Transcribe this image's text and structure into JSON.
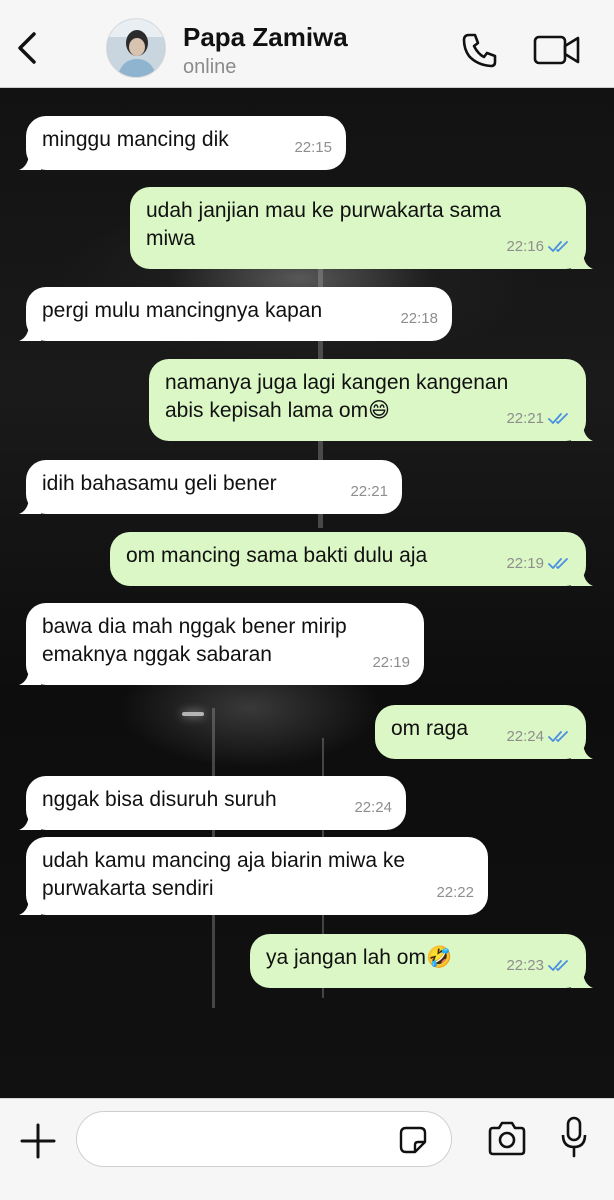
{
  "header": {
    "contact_name": "Papa Zamiwa",
    "status": "online"
  },
  "icons": {
    "back": "chevron-left-icon",
    "call": "phone-icon",
    "video": "video-camera-icon",
    "add": "plus-icon",
    "sticker": "sticker-icon",
    "camera": "camera-icon",
    "mic": "microphone-icon",
    "read_receipt": "double-check-icon"
  },
  "colors": {
    "incoming_bubble": "#ffffff",
    "outgoing_bubble": "#dbf7c5",
    "read_tick": "#4a90e2"
  },
  "messages": [
    {
      "dir": "in",
      "text": "minggu mancing dik",
      "time": "22:15"
    },
    {
      "dir": "out",
      "text": "udah janjian mau ke purwakarta sama\nmiwa",
      "time": "22:16"
    },
    {
      "dir": "in",
      "text": "pergi mulu mancingnya kapan",
      "time": "22:18"
    },
    {
      "dir": "out",
      "text": "namanya juga lagi kangen kangenan\nabis kepisah lama om😄",
      "time": "22:21"
    },
    {
      "dir": "in",
      "text": "idih bahasamu geli bener",
      "time": "22:21"
    },
    {
      "dir": "out",
      "text": "om mancing sama bakti dulu aja",
      "time": "22:19"
    },
    {
      "dir": "in",
      "text": "bawa dia mah nggak bener mirip\nemaknya nggak sabaran",
      "time": "22:19"
    },
    {
      "dir": "out",
      "text": "om raga",
      "time": "22:24"
    },
    {
      "dir": "in",
      "text": "nggak bisa disuruh suruh",
      "time": "22:24"
    },
    {
      "dir": "in",
      "text": "udah kamu mancing aja biarin miwa ke\npurwakarta sendiri",
      "time": "22:22"
    },
    {
      "dir": "out",
      "text": "ya jangan lah om🤣",
      "time": "22:23"
    }
  ],
  "composer": {
    "value": "",
    "placeholder": ""
  }
}
